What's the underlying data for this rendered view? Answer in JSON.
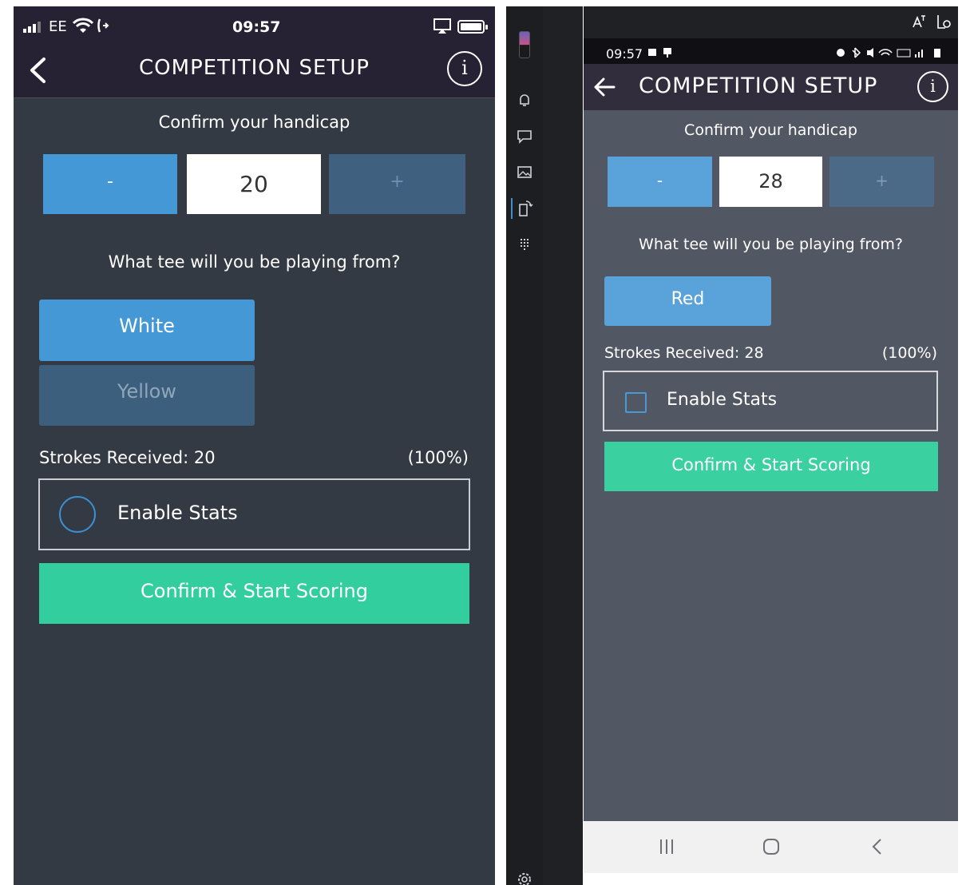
{
  "ios": {
    "status": {
      "carrier": "EE",
      "time": "09:57"
    },
    "header": {
      "title": "COMPETITION SETUP",
      "info_label": "i"
    },
    "handicap": {
      "label": "Confirm your handicap",
      "minus": "-",
      "value": "20",
      "plus": "+"
    },
    "tee": {
      "label": "What tee will you be playing from?",
      "options": [
        "White",
        "Yellow"
      ],
      "selected": "White"
    },
    "strokes": {
      "text": "Strokes Received: 20",
      "percent": "(100%)"
    },
    "stats": {
      "label": "Enable Stats",
      "enabled": false
    },
    "confirm_label": "Confirm & Start Scoring",
    "colors": {
      "header_bg": "#262233",
      "content_bg": "#333a44",
      "accent_blue": "#4498d6",
      "confirm_green": "#33ce9e"
    }
  },
  "android": {
    "status": {
      "time": "09:57"
    },
    "header": {
      "title": "COMPETITION SETUP",
      "info_label": "i"
    },
    "handicap": {
      "label": "Confirm your handicap",
      "minus": "-",
      "value": "28",
      "plus": "+"
    },
    "tee": {
      "label": "What tee will you be playing from?",
      "options": [
        "Red"
      ],
      "selected": "Red"
    },
    "strokes": {
      "text": "Strokes Received: 28",
      "percent": "(100%)"
    },
    "stats": {
      "label": "Enable Stats",
      "enabled": false
    },
    "confirm_label": "Confirm & Start Scoring",
    "colors": {
      "header_bg": "#322d3d",
      "content_bg": "#525863",
      "accent_blue": "#5aa2da",
      "confirm_green": "#3bd0a0"
    }
  },
  "toolbar": {
    "icons": [
      "screen-thumbnail-icon",
      "bell-icon",
      "message-icon",
      "image-icon",
      "rotate-device-icon",
      "dialpad-icon",
      "settings-icon"
    ]
  }
}
